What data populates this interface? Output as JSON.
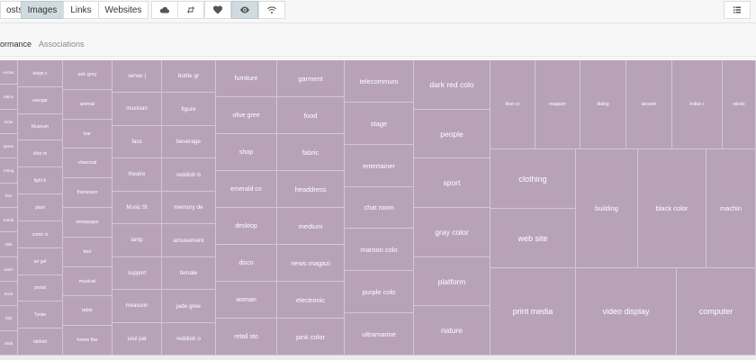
{
  "nav": {
    "tabs": [
      {
        "label": "osts",
        "active": false
      },
      {
        "label": "Images",
        "active": true
      },
      {
        "label": "Links",
        "active": false
      },
      {
        "label": "Websites",
        "active": false
      }
    ],
    "icon_buttons": [
      {
        "icon": "cloud-icon",
        "active": false
      },
      {
        "icon": "retweet-icon",
        "active": false
      },
      {
        "icon": "heart-icon",
        "active": false
      },
      {
        "icon": "eye-icon",
        "active": true
      },
      {
        "icon": "wifi-icon",
        "active": false
      }
    ],
    "view_icon": "list-icon"
  },
  "subtabs": [
    {
      "label": "ormance",
      "active": true
    },
    {
      "label": "Associations",
      "active": false
    }
  ],
  "colors": {
    "tile": "#b8a2b8",
    "tile_border": "#d4c7d4",
    "active_tab": "#cfdbe0"
  },
  "treemap": {
    "columns": [
      [
        "ences",
        "ration",
        "hicle",
        "grass",
        "rming",
        "hes",
        "meral",
        "nkle",
        "wash",
        "ence",
        "hild",
        "ostat"
      ],
      [
        "beige c",
        "overgar",
        "Museum",
        "slick m",
        "light b",
        "plant",
        "comic b",
        "art gal",
        "portal",
        "Tyrian",
        "tabloid"
      ],
      [
        "ash grey",
        "animal",
        "bar",
        "charcoal",
        "framewor",
        "newspape",
        "tool",
        "musical",
        "table",
        "home the"
      ],
      [
        "server |",
        "musician",
        "face",
        "theatre",
        "Music St",
        "lamp",
        "support",
        "measurin",
        "soul pat"
      ],
      [
        "bottle gr",
        "figure",
        "beverage",
        "reddish b",
        "memory de",
        "amusement",
        "female",
        "jade gree",
        "reddish o"
      ],
      [
        "furniture",
        "olive gree",
        "shop",
        "emerald co",
        "desktop",
        "disco",
        "woman",
        "retail sto"
      ],
      [
        "garment",
        "food",
        "fabric",
        "headdress",
        "medium",
        "news magazi",
        "electronic",
        "pink color"
      ],
      [
        "telecommuni",
        "stage",
        "entertainer",
        "chat room",
        "maroon colo",
        "purple colo",
        "ultramarine"
      ],
      [
        "dark red colo",
        "people",
        "sport",
        "gray color",
        "platform",
        "nature"
      ]
    ],
    "top_row": [
      "blue co",
      "magazin",
      "dialog",
      "aboarin",
      "Indian r",
      "windo"
    ],
    "middle_block": {
      "left_stack": [
        "clothing",
        "web site"
      ],
      "right_items": [
        "building",
        "black color",
        "machin"
      ]
    },
    "bottom_row": [
      "print media",
      "video display",
      "computer"
    ]
  }
}
